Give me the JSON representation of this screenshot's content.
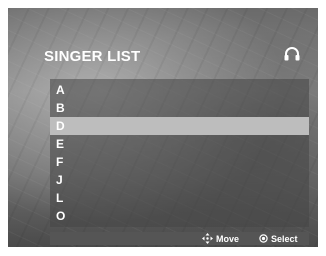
{
  "header": {
    "title": "SINGER LIST",
    "icon": "headphones-icon"
  },
  "list": {
    "items": [
      "A",
      "B",
      "D",
      "E",
      "F",
      "J",
      "L",
      "O"
    ],
    "selected_index": 2
  },
  "footer": {
    "move_label": "Move",
    "move_icon": "dpad-icon",
    "select_label": "Select",
    "select_icon": "select-circle-icon"
  }
}
